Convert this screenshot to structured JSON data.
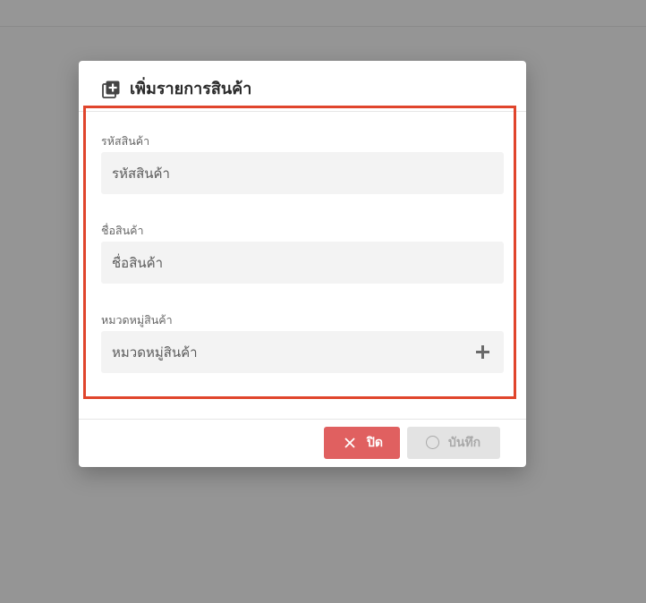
{
  "modal": {
    "title": "เพิ่มรายการสินค้า",
    "header_icon": "add-box-icon"
  },
  "form": {
    "fields": [
      {
        "label": "รหัสสินค้า",
        "placeholder": "รหัสสินค้า"
      },
      {
        "label": "ชื่อสินค้า",
        "placeholder": "ชื่อสินค้า"
      },
      {
        "label": "หมวดหมู่สินค้า",
        "placeholder": "หมวดหมู่สินค้า",
        "action_icon": "plus-icon"
      }
    ],
    "highlight_color": "#e0452c"
  },
  "footer": {
    "close_label": "ปิด",
    "close_icon": "close-icon",
    "close_color": "#e06060",
    "save_label": "บันทึก",
    "save_icon": "circle-icon",
    "save_disabled": true
  }
}
